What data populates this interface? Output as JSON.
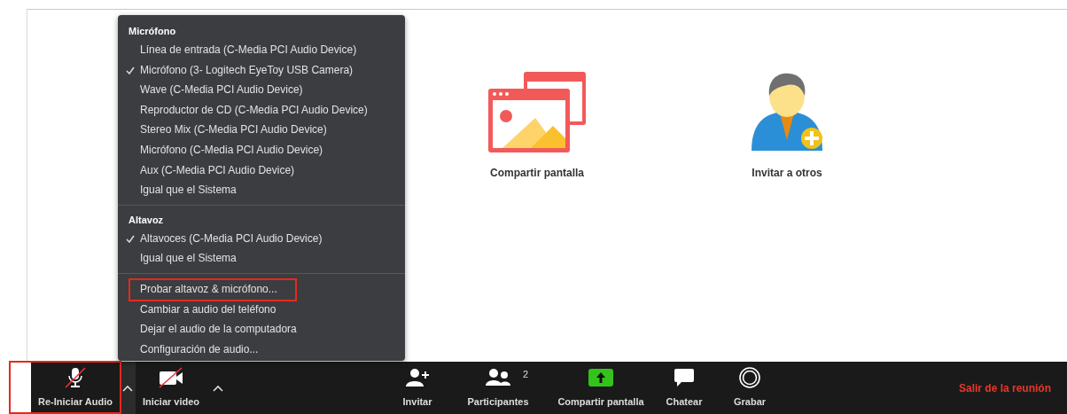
{
  "menu": {
    "sections": [
      {
        "header": "Micrófono",
        "items": [
          {
            "label": "Línea de entrada (C-Media PCI Audio Device)",
            "selected": false
          },
          {
            "label": "Micrófono (3- Logitech EyeToy USB Camera)",
            "selected": true
          },
          {
            "label": "Wave (C-Media PCI Audio Device)",
            "selected": false
          },
          {
            "label": "Reproductor de CD (C-Media PCI Audio Device)",
            "selected": false
          },
          {
            "label": "Stereo Mix (C-Media PCI Audio Device)",
            "selected": false
          },
          {
            "label": "Micrófono (C-Media PCI Audio Device)",
            "selected": false
          },
          {
            "label": "Aux (C-Media PCI Audio Device)",
            "selected": false
          },
          {
            "label": "Igual que el Sistema",
            "selected": false
          }
        ]
      },
      {
        "header": "Altavoz",
        "items": [
          {
            "label": "Altavoces (C-Media PCI Audio Device)",
            "selected": true
          },
          {
            "label": "Igual que el Sistema",
            "selected": false
          }
        ]
      }
    ],
    "actions": [
      {
        "label": "Probar altavoz & micrófono...",
        "highlighted": true
      },
      {
        "label": "Cambiar a audio del teléfono",
        "highlighted": false
      },
      {
        "label": "Dejar el audio de la computadora",
        "highlighted": false
      },
      {
        "label": "Configuración de audio...",
        "highlighted": false
      }
    ]
  },
  "tiles": [
    {
      "kind": "share",
      "label": "Compartir pantalla"
    },
    {
      "kind": "invite",
      "label": "Invitar a otros"
    }
  ],
  "toolbar": {
    "buttons": [
      {
        "kind": "mic",
        "label": "Re-Iniciar Audio",
        "muted": true,
        "has_menu": true,
        "highlighted": true
      },
      {
        "kind": "video",
        "label": "Iniciar video",
        "muted": true,
        "has_menu": true,
        "highlighted": false
      },
      {
        "kind": "invite",
        "label": "Invitar",
        "has_menu": false,
        "highlighted": false
      },
      {
        "kind": "participants",
        "label": "Participantes",
        "count": "2",
        "has_menu": false,
        "highlighted": false
      },
      {
        "kind": "share",
        "label": "Compartir pantalla",
        "has_menu": false,
        "highlighted": false
      },
      {
        "kind": "chat",
        "label": "Chatear",
        "has_menu": false,
        "highlighted": false
      },
      {
        "kind": "record",
        "label": "Grabar",
        "has_menu": false,
        "highlighted": false
      }
    ],
    "leave": "Salir de la reunión"
  }
}
